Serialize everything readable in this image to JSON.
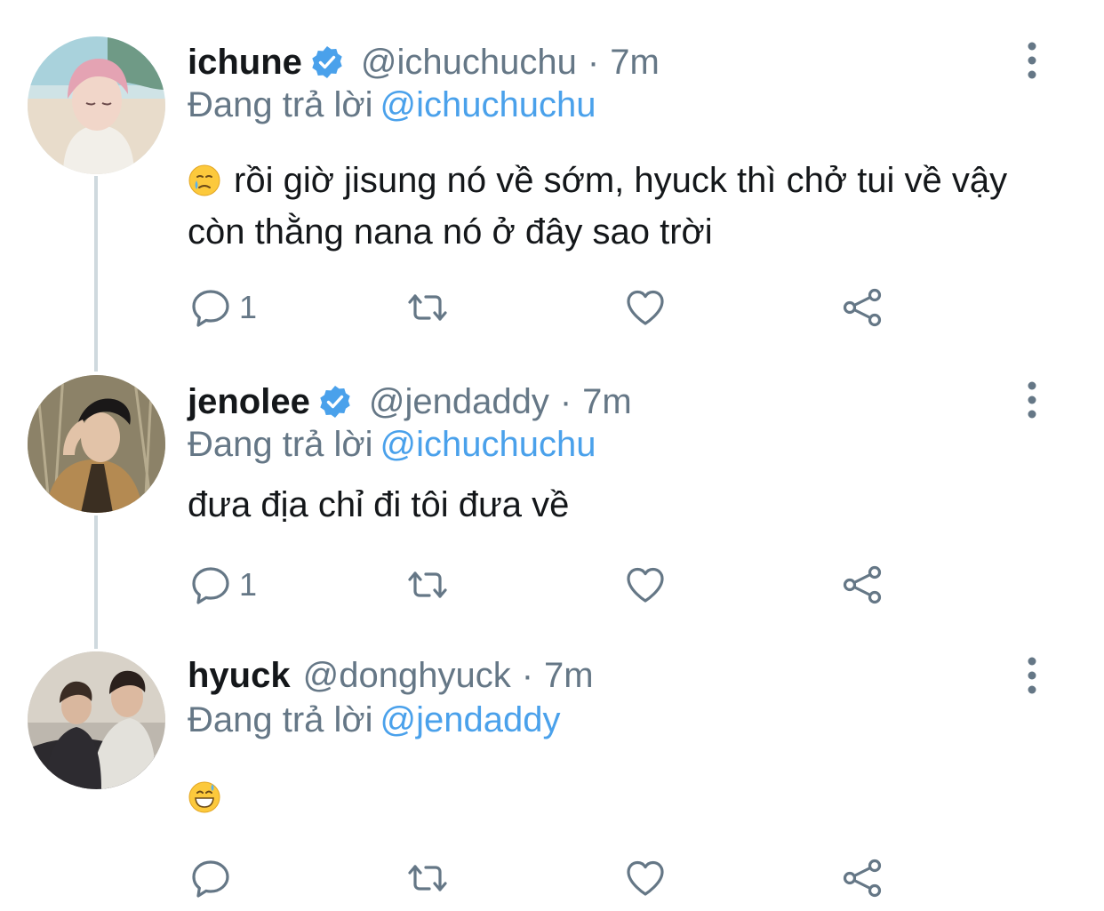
{
  "colors": {
    "accent": "#4aa1eb",
    "secondary_text": "#657786",
    "thread_line": "#cfd9de"
  },
  "tweets": [
    {
      "name": "ichune",
      "verified": true,
      "handle": "@ichuchuchu",
      "time": "7m",
      "replying_label": "Đang trả lời",
      "replying_to": "@ichuchuchu",
      "emoji": "crying-face-emoji",
      "text": "rồi giờ jisung nó về sớm, hyuck thì chở tui về vậy còn thằng nana nó ở đây sao trời",
      "reply_count": "1"
    },
    {
      "name": "jenolee",
      "verified": true,
      "handle": "@jendaddy",
      "time": "7m",
      "replying_label": "Đang trả lời",
      "replying_to": "@ichuchuchu",
      "text": "đưa địa chỉ đi tôi đưa về",
      "reply_count": "1"
    },
    {
      "name": "hyuck",
      "verified": false,
      "handle": "@donghyuck",
      "time": "7m",
      "replying_label": "Đang trả lời",
      "replying_to": "@jendaddy",
      "emoji": "grinning-sweat-emoji",
      "text": "",
      "reply_count": ""
    }
  ]
}
